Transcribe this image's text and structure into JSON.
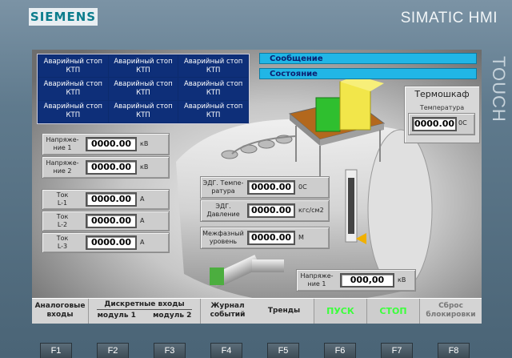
{
  "device": {
    "logo": "SIEMENS",
    "brand": "SIMATIC HMI",
    "touch_label": "TOUCH"
  },
  "estop": {
    "cells": [
      [
        "Аварийный стоп",
        "КТП"
      ],
      [
        "Аварийный стоп",
        "КТП"
      ],
      [
        "Аварийный стоп",
        "КТП"
      ],
      [
        "Аварийный стоп",
        "КТП"
      ],
      [
        "Аварийный стоп",
        "КТП"
      ],
      [
        "Аварийный стоп",
        "КТП"
      ],
      [
        "Аварийный стоп",
        "КТП"
      ],
      [
        "Аварийный стоп",
        "КТП"
      ],
      [
        "Аварийный стоп",
        "КТП"
      ]
    ]
  },
  "bars": {
    "message": "Сообщение",
    "state": "Состояние"
  },
  "thermo": {
    "title": "Термошкаф",
    "temp_label": "Температура",
    "temp_value": "0000.00",
    "temp_unit": "0С"
  },
  "voltage": [
    {
      "label1": "Напряже-",
      "label2": "ние 1",
      "value": "0000.00",
      "unit": "кВ"
    },
    {
      "label1": "Напряже-",
      "label2": "ние 2",
      "value": "0000.00",
      "unit": "кВ"
    }
  ],
  "current": [
    {
      "label1": "Ток",
      "label2": "L-1",
      "value": "0000.00",
      "unit": "А"
    },
    {
      "label1": "Ток",
      "label2": "L-2",
      "value": "0000.00",
      "unit": "А"
    },
    {
      "label1": "Ток",
      "label2": "L-3",
      "value": "0000.00",
      "unit": "А"
    }
  ],
  "edg": [
    {
      "label1": "ЭДГ. Темпе-",
      "label2": "ратура",
      "value": "0000.00",
      "unit": "0С"
    },
    {
      "label1": "ЭДГ.",
      "label2": "Давление",
      "value": "0000.00",
      "unit": "кгс/см2"
    },
    {
      "label1": "Межфазный",
      "label2": "уровень",
      "value": "0000.00",
      "unit": "М"
    }
  ],
  "bottom_voltage": {
    "label1": "Напряже-",
    "label2": "ние 1",
    "value": "000,00",
    "unit": "кВ"
  },
  "nav": {
    "analog1": "Аналоговые",
    "analog2": "входы",
    "discrete_title": "Дискретные входы",
    "module1": "модуль 1",
    "module2": "модуль 2",
    "journal1": "Журнал",
    "journal2": "событий",
    "trends": "Тренды",
    "start": "ПУСК",
    "stop": "СТОП",
    "reset1": "Сброс",
    "reset2": "блокировки"
  },
  "fkeys": [
    "F1",
    "F2",
    "F3",
    "F4",
    "F5",
    "F6",
    "F7",
    "F8"
  ],
  "colors": {
    "accent_cyan": "#21b6e6",
    "estop_blue": "#0e2f79",
    "start_stop_green": "#3cff3c"
  }
}
